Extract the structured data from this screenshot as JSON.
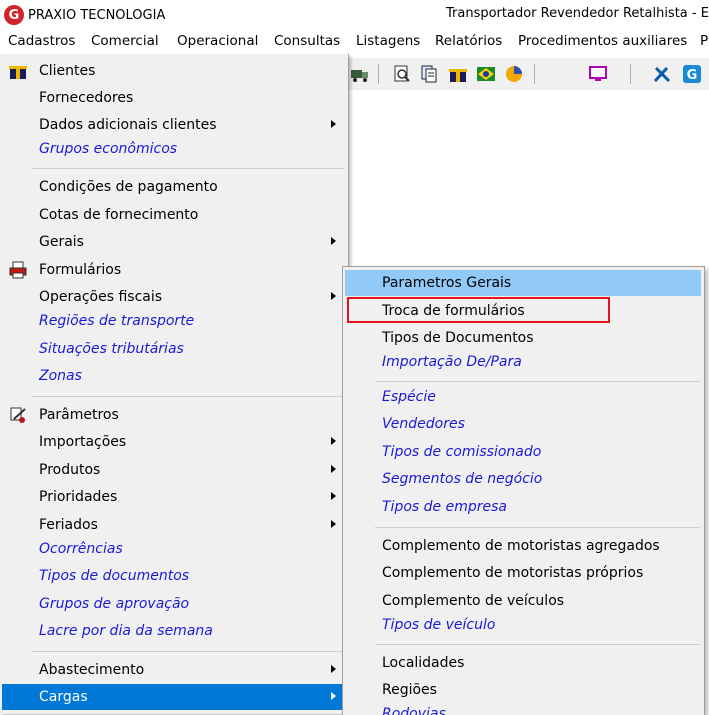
{
  "window": {
    "app_name": "PRAXIO TECNOLOGIA",
    "title": "Transportador Revendedor Retalhista - E",
    "logo_letter": "G",
    "colors": {
      "logo": "#d2232a",
      "highlight": "#0078d7",
      "hover": "#91c9f7",
      "italic_text": "#1a1ad6",
      "annotation": "#e0141e"
    }
  },
  "menubar": [
    "Cadastros",
    "Comercial",
    "Operacional",
    "Consultas",
    "Listagens",
    "Relatórios",
    "Procedimentos auxiliares",
    "P"
  ],
  "toolbar": [
    "truck-icon",
    "print-preview-icon",
    "documents-icon",
    "gift-icon",
    "brazil-flag-icon",
    "pie-chart-icon",
    "monitor-icon",
    "tools-icon",
    "g-logo-icon"
  ],
  "cadastros_menu": [
    {
      "label": "Clientes",
      "icon": "gift-icon",
      "italic": false,
      "submenu": false
    },
    {
      "label": "Fornecedores",
      "italic": false,
      "submenu": false
    },
    {
      "label": "Dados adicionais clientes",
      "italic": false,
      "submenu": true
    },
    {
      "label": "Grupos econômicos",
      "italic": true,
      "submenu": false
    },
    {
      "label": "Condições de pagamento",
      "italic": false,
      "submenu": false
    },
    {
      "label": "Cotas de fornecimento",
      "italic": false,
      "submenu": false
    },
    {
      "label": "Gerais",
      "italic": false,
      "submenu": true
    },
    {
      "label": "Formulários",
      "icon": "printer-icon",
      "italic": false,
      "submenu": false
    },
    {
      "label": "Operações fiscais",
      "italic": false,
      "submenu": true
    },
    {
      "label": "Regiões de transporte",
      "italic": true,
      "submenu": false
    },
    {
      "label": "Situações tributárias",
      "italic": true,
      "submenu": false
    },
    {
      "label": "Zonas",
      "italic": true,
      "submenu": false
    },
    {
      "label": "Parâmetros",
      "icon": "parameters-icon",
      "italic": false,
      "submenu": false
    },
    {
      "label": "Importações",
      "italic": false,
      "submenu": true
    },
    {
      "label": "Produtos",
      "italic": false,
      "submenu": true
    },
    {
      "label": "Prioridades",
      "italic": false,
      "submenu": true
    },
    {
      "label": "Feriados",
      "italic": false,
      "submenu": true
    },
    {
      "label": "Ocorrências",
      "italic": true,
      "submenu": false
    },
    {
      "label": "Tipos de documentos",
      "italic": true,
      "submenu": false
    },
    {
      "label": "Grupos de aprovação",
      "italic": true,
      "submenu": false
    },
    {
      "label": "Lacre por dia da semana",
      "italic": true,
      "submenu": false
    },
    {
      "label": "Abastecimento",
      "italic": false,
      "submenu": true
    },
    {
      "label": "Cargas",
      "italic": false,
      "submenu": true,
      "selected": true
    }
  ],
  "cargas_submenu": [
    {
      "label": "Parametros Gerais",
      "italic": false,
      "hover": true
    },
    {
      "label": "Troca de formulários",
      "italic": false,
      "annotated": true
    },
    {
      "label": "Tipos de Documentos",
      "italic": false
    },
    {
      "label": "Importação De/Para",
      "italic": true
    },
    {
      "label": "Espécie",
      "italic": true
    },
    {
      "label": "Vendedores",
      "italic": true
    },
    {
      "label": "Tipos de  comissionado",
      "italic": true
    },
    {
      "label": "Segmentos de negócio",
      "italic": true
    },
    {
      "label": "Tipos de empresa",
      "italic": true
    },
    {
      "label": "Complemento de motoristas agregados",
      "italic": false
    },
    {
      "label": "Complemento de motoristas próprios",
      "italic": false
    },
    {
      "label": "Complemento de veículos",
      "italic": false
    },
    {
      "label": "Tipos de veículo",
      "italic": true
    },
    {
      "label": "Localidades",
      "italic": false
    },
    {
      "label": "Regiões",
      "italic": false
    },
    {
      "label": "Rodovias",
      "italic": true
    }
  ]
}
